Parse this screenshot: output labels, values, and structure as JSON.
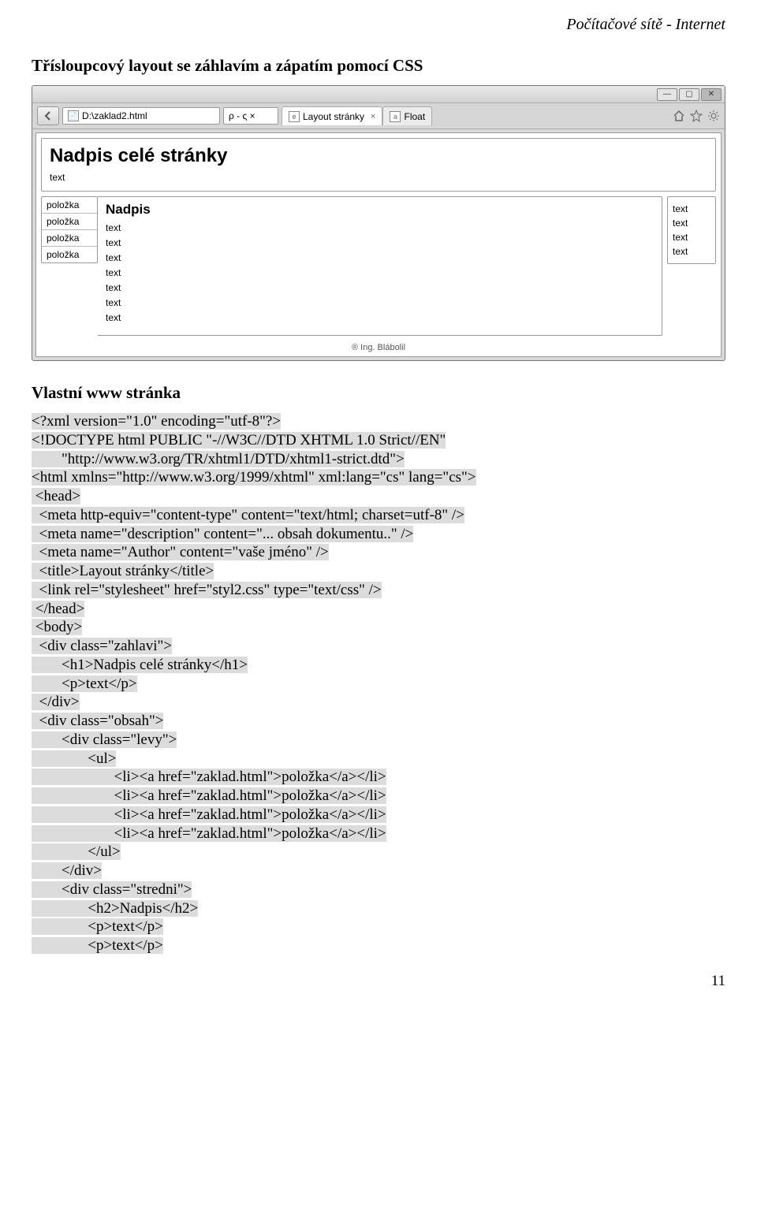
{
  "header_right": "Počítačové sítě - Internet",
  "section_title": "Třísloupcový layout se záhlavím a zápatím pomocí CSS",
  "browser": {
    "url": "D:\\zaklad2.html",
    "search_hint": "ρ - ς ×",
    "tabs": [
      {
        "title": "Layout stránky",
        "active": true
      },
      {
        "title": "Float",
        "active": false
      }
    ]
  },
  "page": {
    "header": {
      "title": "Nadpis celé stránky",
      "text": "text"
    },
    "left_menu": [
      "položka",
      "položka",
      "položka",
      "položka"
    ],
    "mid": {
      "title": "Nadpis",
      "paras": [
        "text",
        "text",
        "text",
        "text",
        "text",
        "text",
        "text"
      ]
    },
    "right": [
      "text",
      "text",
      "text",
      "text"
    ],
    "footer": "® Ing. Blábolil"
  },
  "subtitle": "Vlastní www stránka",
  "code": {
    "l1": "<?xml version=\"1.0\" encoding=\"utf-8\"?>",
    "l2": "<!DOCTYPE html PUBLIC \"-//W3C//DTD XHTML 1.0 Strict//EN\"",
    "l3": "        \"http://www.w3.org/TR/xhtml1/DTD/xhtml1-strict.dtd\">",
    "l4": "<html xmlns=\"http://www.w3.org/1999/xhtml\" xml:lang=\"cs\" lang=\"cs\">",
    "l5": " <head>",
    "l6": "  <meta http-equiv=\"content-type\" content=\"text/html; charset=utf-8\" />",
    "l7": "  <meta name=\"description\" content=\"... obsah dokumentu..\" />",
    "l8": "  <meta name=\"Author\" content=\"vaše jméno\" />",
    "l9": "  <title>Layout stránky</title>",
    "l10": "  <link rel=\"stylesheet\" href=\"styl2.css\" type=\"text/css\" />",
    "l11": " </head>",
    "l12": " <body>",
    "l13": "  <div class=\"zahlavi\">",
    "l14": "        <h1>Nadpis celé stránky</h1>",
    "l15": "        <p>text</p>",
    "l16": "  </div>",
    "l17": "  <div class=\"obsah\">",
    "l18": "        <div class=\"levy\">",
    "l19": "               <ul>",
    "l20": "                      <li><a href=\"zaklad.html\">položka</a></li>",
    "l21": "                      <li><a href=\"zaklad.html\">položka</a></li>",
    "l22": "                      <li><a href=\"zaklad.html\">položka</a></li>",
    "l23": "                      <li><a href=\"zaklad.html\">položka</a></li>",
    "l24": "               </ul>",
    "l25": "        </div>",
    "l26": "        <div class=\"stredni\">",
    "l27": "               <h2>Nadpis</h2>",
    "l28": "               <p>text</p>",
    "l29": "               <p>text</p>"
  },
  "page_number": "11"
}
